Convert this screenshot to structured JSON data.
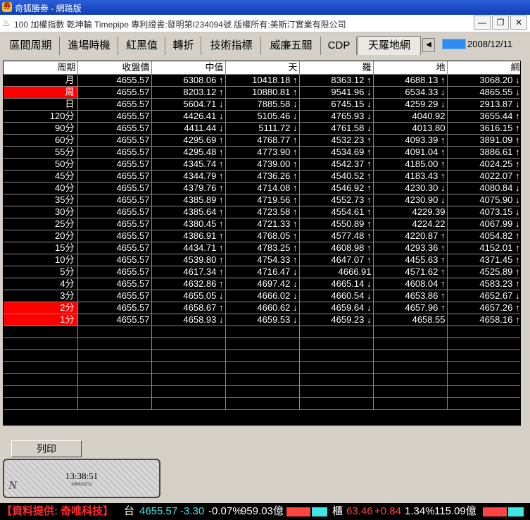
{
  "window": {
    "title": "奇狐勝券 - 網路版"
  },
  "header": {
    "ticker_text": "100 加權指數    乾坤輪 Timepipe 專利證書:發明第I234094號 版權所有:美斯汀實業有限公司",
    "minimize": "—",
    "restore": "❐",
    "close": "✕"
  },
  "tabs": [
    {
      "label": "區間周期"
    },
    {
      "label": "進場時機"
    },
    {
      "label": "紅黑值"
    },
    {
      "label": "轉折"
    },
    {
      "label": "技術指標"
    },
    {
      "label": "威廉五關"
    },
    {
      "label": "CDP"
    },
    {
      "label": "天羅地網",
      "active": true
    }
  ],
  "tab_arrow": "◀",
  "date": "2008/12/11",
  "table": {
    "headers": [
      "周期",
      "收盤價",
      "中值",
      "天",
      "羅",
      "地",
      "網"
    ],
    "rows": [
      {
        "period": "月",
        "highlight": false,
        "close": "4655.57",
        "mid": "6308.06 ↑",
        "tian": "10418.18 ↑",
        "luo": "8363.12 ↑",
        "di": "4688.13 ↑",
        "wang": "3068.20 ↓"
      },
      {
        "period": "周",
        "highlight": true,
        "close": "4655.57",
        "mid": "8203.12 ↑",
        "tian": "10880.81 ↑",
        "luo": "9541.96 ↓",
        "di": "6534.33 ↓",
        "wang": "4865.55 ↓"
      },
      {
        "period": "日",
        "highlight": false,
        "close": "4655.57",
        "mid": "5604.71 ↓",
        "tian": "7885.58 ↓",
        "luo": "6745.15 ↓",
        "di": "4259.29 ↓",
        "wang": "2913.87 ↓"
      },
      {
        "period": "120分",
        "highlight": false,
        "close": "4655.57",
        "mid": "4426.41 ↓",
        "tian": "5105.46 ↓",
        "luo": "4765.93 ↓",
        "di": "4040.92",
        "wang": "3655.44 ↑"
      },
      {
        "period": "90分",
        "highlight": false,
        "close": "4655.57",
        "mid": "4411.44 ↓",
        "tian": "5111.72 ↓",
        "luo": "4761.58 ↓",
        "di": "4013.80",
        "wang": "3616.15 ↑"
      },
      {
        "period": "60分",
        "highlight": false,
        "close": "4655.57",
        "mid": "4295.69 ↑",
        "tian": "4768.77 ↑",
        "luo": "4532.23 ↑",
        "di": "4093.39 ↑",
        "wang": "3891.09 ↑"
      },
      {
        "period": "55分",
        "highlight": false,
        "close": "4655.57",
        "mid": "4295.48 ↑",
        "tian": "4773.90 ↑",
        "luo": "4534.69 ↑",
        "di": "4091.04 ↑",
        "wang": "3886.61 ↑"
      },
      {
        "period": "50分",
        "highlight": false,
        "close": "4655.57",
        "mid": "4345.74 ↑",
        "tian": "4739.00 ↑",
        "luo": "4542.37 ↑",
        "di": "4185.00 ↑",
        "wang": "4024.25 ↑"
      },
      {
        "period": "45分",
        "highlight": false,
        "close": "4655.57",
        "mid": "4344.79 ↑",
        "tian": "4736.26 ↑",
        "luo": "4540.52 ↑",
        "di": "4183.43 ↑",
        "wang": "4022.07 ↑"
      },
      {
        "period": "40分",
        "highlight": false,
        "close": "4655.57",
        "mid": "4379.76 ↑",
        "tian": "4714.08 ↑",
        "luo": "4546.92 ↑",
        "di": "4230.30 ↓",
        "wang": "4080.84 ↓"
      },
      {
        "period": "35分",
        "highlight": false,
        "close": "4655.57",
        "mid": "4385.89 ↑",
        "tian": "4719.56 ↑",
        "luo": "4552.73 ↑",
        "di": "4230.90 ↓",
        "wang": "4075.90 ↓"
      },
      {
        "period": "30分",
        "highlight": false,
        "close": "4655.57",
        "mid": "4385.64 ↑",
        "tian": "4723.58 ↑",
        "luo": "4554.61 ↑",
        "di": "4229.39",
        "wang": "4073.15 ↓"
      },
      {
        "period": "25分",
        "highlight": false,
        "close": "4655.57",
        "mid": "4380.45 ↑",
        "tian": "4721.33 ↑",
        "luo": "4550.89 ↑",
        "di": "4224.22",
        "wang": "4067.99 ↓"
      },
      {
        "period": "20分",
        "highlight": false,
        "close": "4655.57",
        "mid": "4386.91 ↑",
        "tian": "4768.05 ↑",
        "luo": "4577.48 ↑",
        "di": "4220.87 ↑",
        "wang": "4054.82 ↑"
      },
      {
        "period": "15分",
        "highlight": false,
        "close": "4655.57",
        "mid": "4434.71 ↑",
        "tian": "4783.25 ↑",
        "luo": "4608.98 ↑",
        "di": "4293.36 ↑",
        "wang": "4152.01 ↑"
      },
      {
        "period": "10分",
        "highlight": false,
        "close": "4655.57",
        "mid": "4539.80 ↑",
        "tian": "4754.33 ↑",
        "luo": "4647.07 ↑",
        "di": "4455.63 ↑",
        "wang": "4371.45 ↑"
      },
      {
        "period": "5分",
        "highlight": false,
        "close": "4655.57",
        "mid": "4617.34 ↑",
        "tian": "4716.47 ↓",
        "luo": "4666.91",
        "di": "4571.62 ↑",
        "wang": "4525.89 ↑"
      },
      {
        "period": "4分",
        "highlight": false,
        "close": "4655.57",
        "mid": "4632.86 ↑",
        "tian": "4697.42 ↓",
        "luo": "4665.14 ↓",
        "di": "4608.04 ↑",
        "wang": "4583.23 ↑"
      },
      {
        "period": "3分",
        "highlight": false,
        "close": "4655.57",
        "mid": "4655.05 ↓",
        "tian": "4666.02 ↓",
        "luo": "4660.54 ↓",
        "di": "4653.86 ↑",
        "wang": "4652.67 ↓"
      },
      {
        "period": "2分",
        "highlight": true,
        "close": "4655.57",
        "mid": "4658.67 ↑",
        "tian": "4660.62 ↓",
        "luo": "4659.64 ↓",
        "di": "4657.96 ↑",
        "wang": "4657.26 ↑"
      },
      {
        "period": "1分",
        "highlight": true,
        "close": "4655.57",
        "mid": "4658.93 ↓",
        "tian": "4659.53 ↓",
        "luo": "4659.23 ↓",
        "di": "4658.55",
        "wang": "4658.16 ↑"
      }
    ]
  },
  "print_label": "列印",
  "clock": {
    "time": "13:38:51",
    "date": "2008/12/11",
    "mark": "N"
  },
  "status": {
    "provider": "【資料提供: 奇唯科技】",
    "twse": {
      "label": "台",
      "index": "4655.57",
      "change": "-3.30",
      "pct": "-0.07%",
      "volume": "959.03億"
    },
    "otc": {
      "label": "櫃",
      "index": "63.46",
      "change": "+0.84",
      "pct": "1.34%",
      "volume": "115.09億"
    },
    "colors": {
      "red": "#ff4444",
      "cyan": "#3ee6e6",
      "highlight": "#ff0000",
      "tab_date_box": "#2c8cf0"
    }
  }
}
